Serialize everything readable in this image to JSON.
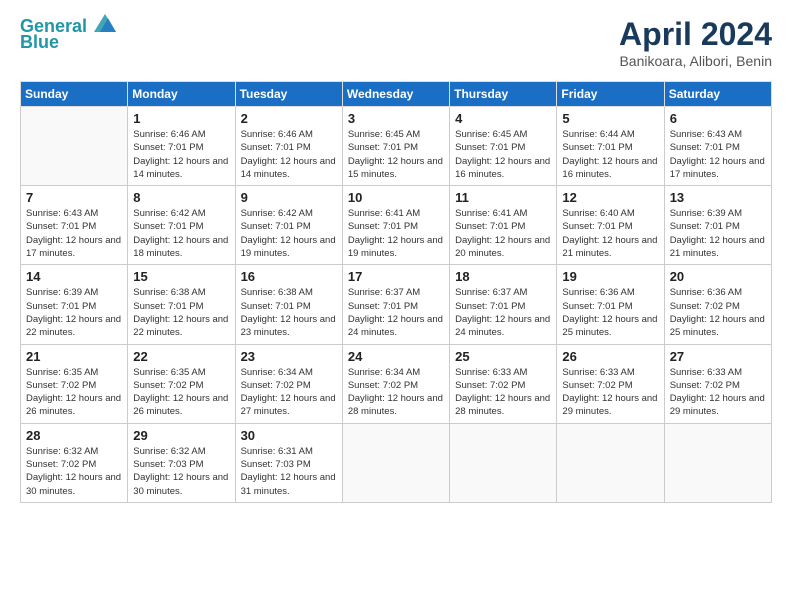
{
  "header": {
    "logo_line1": "General",
    "logo_line2": "Blue",
    "month_title": "April 2024",
    "location": "Banikoara, Alibori, Benin"
  },
  "days_of_week": [
    "Sunday",
    "Monday",
    "Tuesday",
    "Wednesday",
    "Thursday",
    "Friday",
    "Saturday"
  ],
  "weeks": [
    [
      {
        "day": "",
        "sunrise": "",
        "sunset": "",
        "daylight": ""
      },
      {
        "day": "1",
        "sunrise": "Sunrise: 6:46 AM",
        "sunset": "Sunset: 7:01 PM",
        "daylight": "Daylight: 12 hours and 14 minutes."
      },
      {
        "day": "2",
        "sunrise": "Sunrise: 6:46 AM",
        "sunset": "Sunset: 7:01 PM",
        "daylight": "Daylight: 12 hours and 14 minutes."
      },
      {
        "day": "3",
        "sunrise": "Sunrise: 6:45 AM",
        "sunset": "Sunset: 7:01 PM",
        "daylight": "Daylight: 12 hours and 15 minutes."
      },
      {
        "day": "4",
        "sunrise": "Sunrise: 6:45 AM",
        "sunset": "Sunset: 7:01 PM",
        "daylight": "Daylight: 12 hours and 16 minutes."
      },
      {
        "day": "5",
        "sunrise": "Sunrise: 6:44 AM",
        "sunset": "Sunset: 7:01 PM",
        "daylight": "Daylight: 12 hours and 16 minutes."
      },
      {
        "day": "6",
        "sunrise": "Sunrise: 6:43 AM",
        "sunset": "Sunset: 7:01 PM",
        "daylight": "Daylight: 12 hours and 17 minutes."
      }
    ],
    [
      {
        "day": "7",
        "sunrise": "Sunrise: 6:43 AM",
        "sunset": "Sunset: 7:01 PM",
        "daylight": "Daylight: 12 hours and 17 minutes."
      },
      {
        "day": "8",
        "sunrise": "Sunrise: 6:42 AM",
        "sunset": "Sunset: 7:01 PM",
        "daylight": "Daylight: 12 hours and 18 minutes."
      },
      {
        "day": "9",
        "sunrise": "Sunrise: 6:42 AM",
        "sunset": "Sunset: 7:01 PM",
        "daylight": "Daylight: 12 hours and 19 minutes."
      },
      {
        "day": "10",
        "sunrise": "Sunrise: 6:41 AM",
        "sunset": "Sunset: 7:01 PM",
        "daylight": "Daylight: 12 hours and 19 minutes."
      },
      {
        "day": "11",
        "sunrise": "Sunrise: 6:41 AM",
        "sunset": "Sunset: 7:01 PM",
        "daylight": "Daylight: 12 hours and 20 minutes."
      },
      {
        "day": "12",
        "sunrise": "Sunrise: 6:40 AM",
        "sunset": "Sunset: 7:01 PM",
        "daylight": "Daylight: 12 hours and 21 minutes."
      },
      {
        "day": "13",
        "sunrise": "Sunrise: 6:39 AM",
        "sunset": "Sunset: 7:01 PM",
        "daylight": "Daylight: 12 hours and 21 minutes."
      }
    ],
    [
      {
        "day": "14",
        "sunrise": "Sunrise: 6:39 AM",
        "sunset": "Sunset: 7:01 PM",
        "daylight": "Daylight: 12 hours and 22 minutes."
      },
      {
        "day": "15",
        "sunrise": "Sunrise: 6:38 AM",
        "sunset": "Sunset: 7:01 PM",
        "daylight": "Daylight: 12 hours and 22 minutes."
      },
      {
        "day": "16",
        "sunrise": "Sunrise: 6:38 AM",
        "sunset": "Sunset: 7:01 PM",
        "daylight": "Daylight: 12 hours and 23 minutes."
      },
      {
        "day": "17",
        "sunrise": "Sunrise: 6:37 AM",
        "sunset": "Sunset: 7:01 PM",
        "daylight": "Daylight: 12 hours and 24 minutes."
      },
      {
        "day": "18",
        "sunrise": "Sunrise: 6:37 AM",
        "sunset": "Sunset: 7:01 PM",
        "daylight": "Daylight: 12 hours and 24 minutes."
      },
      {
        "day": "19",
        "sunrise": "Sunrise: 6:36 AM",
        "sunset": "Sunset: 7:01 PM",
        "daylight": "Daylight: 12 hours and 25 minutes."
      },
      {
        "day": "20",
        "sunrise": "Sunrise: 6:36 AM",
        "sunset": "Sunset: 7:02 PM",
        "daylight": "Daylight: 12 hours and 25 minutes."
      }
    ],
    [
      {
        "day": "21",
        "sunrise": "Sunrise: 6:35 AM",
        "sunset": "Sunset: 7:02 PM",
        "daylight": "Daylight: 12 hours and 26 minutes."
      },
      {
        "day": "22",
        "sunrise": "Sunrise: 6:35 AM",
        "sunset": "Sunset: 7:02 PM",
        "daylight": "Daylight: 12 hours and 26 minutes."
      },
      {
        "day": "23",
        "sunrise": "Sunrise: 6:34 AM",
        "sunset": "Sunset: 7:02 PM",
        "daylight": "Daylight: 12 hours and 27 minutes."
      },
      {
        "day": "24",
        "sunrise": "Sunrise: 6:34 AM",
        "sunset": "Sunset: 7:02 PM",
        "daylight": "Daylight: 12 hours and 28 minutes."
      },
      {
        "day": "25",
        "sunrise": "Sunrise: 6:33 AM",
        "sunset": "Sunset: 7:02 PM",
        "daylight": "Daylight: 12 hours and 28 minutes."
      },
      {
        "day": "26",
        "sunrise": "Sunrise: 6:33 AM",
        "sunset": "Sunset: 7:02 PM",
        "daylight": "Daylight: 12 hours and 29 minutes."
      },
      {
        "day": "27",
        "sunrise": "Sunrise: 6:33 AM",
        "sunset": "Sunset: 7:02 PM",
        "daylight": "Daylight: 12 hours and 29 minutes."
      }
    ],
    [
      {
        "day": "28",
        "sunrise": "Sunrise: 6:32 AM",
        "sunset": "Sunset: 7:02 PM",
        "daylight": "Daylight: 12 hours and 30 minutes."
      },
      {
        "day": "29",
        "sunrise": "Sunrise: 6:32 AM",
        "sunset": "Sunset: 7:03 PM",
        "daylight": "Daylight: 12 hours and 30 minutes."
      },
      {
        "day": "30",
        "sunrise": "Sunrise: 6:31 AM",
        "sunset": "Sunset: 7:03 PM",
        "daylight": "Daylight: 12 hours and 31 minutes."
      },
      {
        "day": "",
        "sunrise": "",
        "sunset": "",
        "daylight": ""
      },
      {
        "day": "",
        "sunrise": "",
        "sunset": "",
        "daylight": ""
      },
      {
        "day": "",
        "sunrise": "",
        "sunset": "",
        "daylight": ""
      },
      {
        "day": "",
        "sunrise": "",
        "sunset": "",
        "daylight": ""
      }
    ]
  ]
}
